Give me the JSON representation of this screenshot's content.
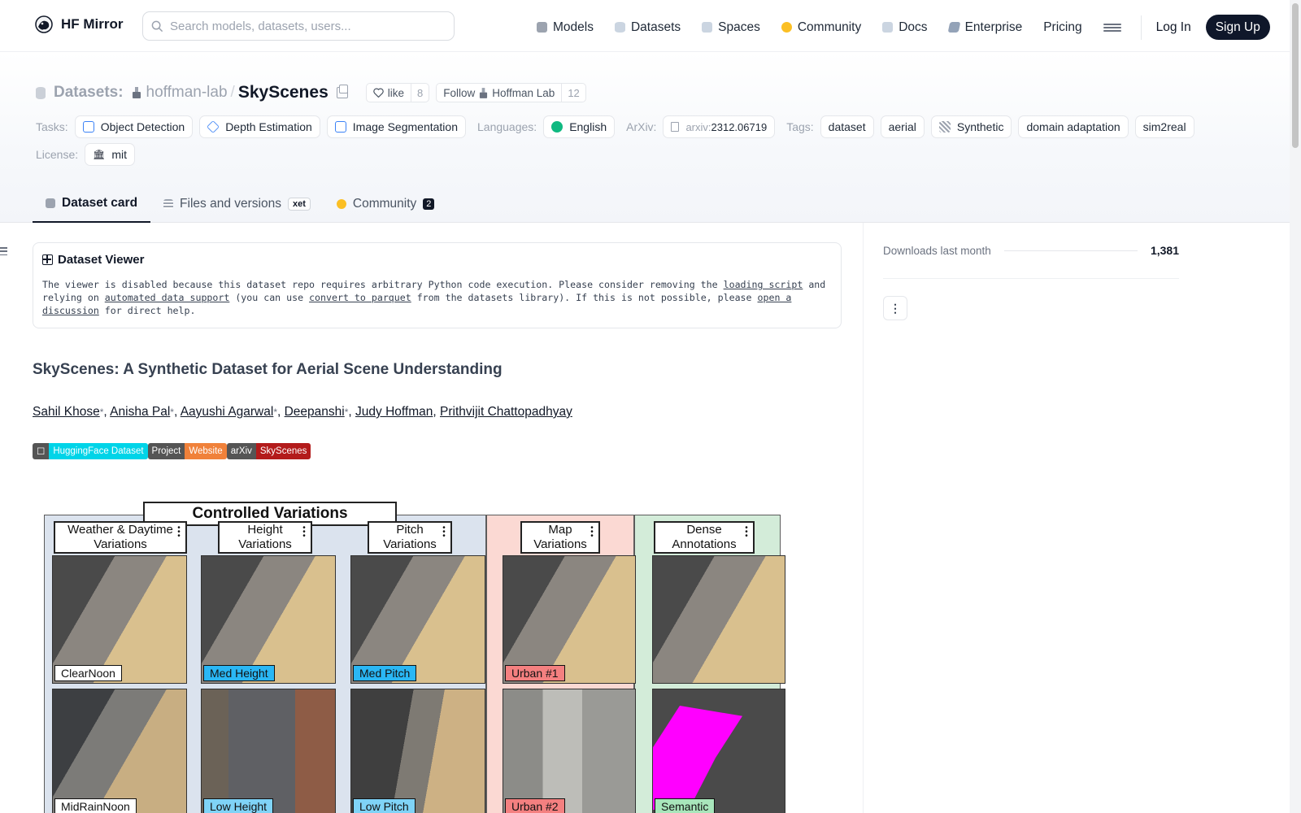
{
  "nav": {
    "brand": "HF Mirror",
    "search_placeholder": "Search models, datasets, users...",
    "links": [
      {
        "label": "Models",
        "color": "#9ca3af"
      },
      {
        "label": "Datasets",
        "color": "#cbd5e1"
      },
      {
        "label": "Spaces",
        "color": "#cbd5e1"
      },
      {
        "label": "Community",
        "color": "#fbbf24"
      },
      {
        "label": "Docs",
        "color": "#cbd5e1"
      },
      {
        "label": "Enterprise",
        "color": "#94a3b8"
      },
      {
        "label": "Pricing",
        "color": ""
      }
    ],
    "login": "Log In",
    "signup": "Sign Up"
  },
  "repo": {
    "crumb_label": "Datasets:",
    "owner": "hoffman-lab",
    "name": "SkyScenes",
    "like_label": "like",
    "like_count": "8",
    "follow_label": "Follow",
    "follow_org": "Hoffman Lab",
    "follow_count": "12"
  },
  "meta": {
    "tasks_label": "Tasks:",
    "tasks": [
      "Object Detection",
      "Depth Estimation",
      "Image Segmentation"
    ],
    "languages_label": "Languages:",
    "language": "English",
    "arxiv_label": "ArXiv:",
    "arxiv_prefix": "arxiv:",
    "arxiv_id": "2312.06719",
    "tags_label": "Tags:",
    "tags": [
      "dataset",
      "aerial",
      "Synthetic",
      "domain adaptation",
      "sim2real"
    ],
    "license_label": "License:",
    "license": "mit"
  },
  "tabs": {
    "card": "Dataset card",
    "files": "Files and versions",
    "xet": "xet",
    "community": "Community",
    "community_count": "2"
  },
  "viewer": {
    "title": "Dataset Viewer",
    "msg_1": "The viewer is disabled because this dataset repo requires arbitrary Python code execution. Please consider removing the ",
    "link_1": "loading script",
    "msg_2": " and relying on ",
    "link_2": "automated data support",
    "msg_3": " (you can use ",
    "link_3": "convert to parquet",
    "msg_4": " from the datasets library). If this is not possible, please ",
    "link_4": "open a discussion",
    "msg_5": " for direct help."
  },
  "card": {
    "title": "SkyScenes: A Synthetic Dataset for Aerial Scene Understanding",
    "authors": [
      {
        "name": "Sahil Khose",
        "star": "*"
      },
      {
        "name": "Anisha Pal",
        "star": "*"
      },
      {
        "name": "Aayushi Agarwal",
        "star": "*"
      },
      {
        "name": "Deepanshi",
        "star": "*"
      },
      {
        "name": "Judy Hoffman",
        "star": ""
      },
      {
        "name": "Prithvijit Chattopadhyay",
        "star": ""
      }
    ],
    "badges": [
      {
        "left": "☐",
        "right": "HuggingFace Dataset",
        "color": "#00d4e8"
      },
      {
        "left": "Project",
        "right": "Website",
        "color": "#f0813a"
      },
      {
        "left": "arXiv",
        "right": "SkyScenes",
        "color": "#b31b1b"
      }
    ]
  },
  "figure": {
    "header": "Controlled Variations",
    "columns": [
      {
        "head": "Weather & Daytime\nVariations",
        "top_label": "ClearNoon",
        "bottom_label": "MidRainNoon",
        "top_color": "#ffffff",
        "bottom_color": "#ffffff"
      },
      {
        "head": "Height\nVariations",
        "top_label": "Med Height",
        "bottom_label": "Low Height",
        "top_color": "#2ab7f5",
        "bottom_color": "#7fd3f7"
      },
      {
        "head": "Pitch\nVariations",
        "top_label": "Med Pitch",
        "bottom_label": "Low Pitch",
        "top_color": "#2ab7f5",
        "bottom_color": "#7fd3f7"
      },
      {
        "head": "Map\nVariations",
        "top_label": "Urban #1",
        "bottom_label": "Urban #2",
        "top_color": "#f48080",
        "bottom_color": "#f48080"
      },
      {
        "head": "Dense\nAnnotations",
        "top_label": "",
        "bottom_label": "Semantic",
        "top_color": "#ffffff",
        "bottom_color": "#a8e6bb"
      }
    ],
    "panel_colors": {
      "controlled": "#dbe3ee",
      "map": "#fbd9d3",
      "dense": "#d3ecd9"
    }
  },
  "sidebar": {
    "downloads_label": "Downloads last month",
    "downloads_value": "1,381",
    "kebab": "⋮"
  }
}
